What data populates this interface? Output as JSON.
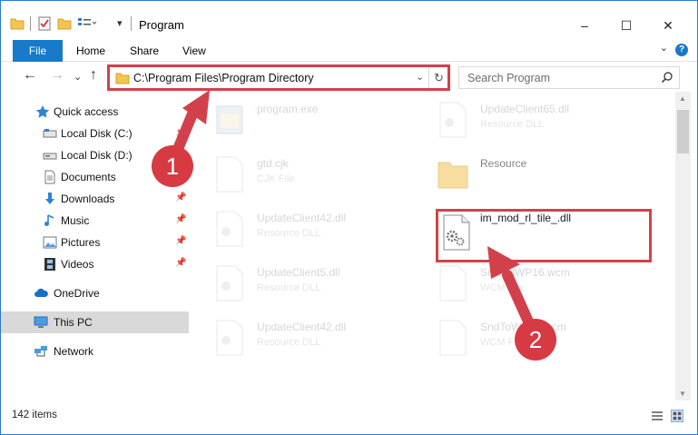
{
  "window": {
    "title": "Program",
    "minimize": "–",
    "maximize": "☐",
    "close": "✕"
  },
  "ribbon": {
    "file": "File",
    "home": "Home",
    "share": "Share",
    "view": "View",
    "help": "?"
  },
  "address": {
    "path": "C:\\Program Files\\Program Directory",
    "dropdown": "⌄",
    "refresh": "↻"
  },
  "search": {
    "placeholder": "Search Program"
  },
  "nav": {
    "back": "←",
    "forward": "→",
    "recent": "⌄",
    "up": "↑",
    "items": [
      {
        "label": "Quick access"
      },
      {
        "label": "Local Disk (C:)"
      },
      {
        "label": "Local Disk (D:)"
      },
      {
        "label": "Documents"
      },
      {
        "label": "Downloads"
      },
      {
        "label": "Music"
      },
      {
        "label": "Pictures"
      },
      {
        "label": "Videos"
      },
      {
        "label": "OneDrive"
      },
      {
        "label": "This PC"
      },
      {
        "label": "Network"
      }
    ],
    "pin": "📌"
  },
  "files": [
    {
      "name": "program.exe",
      "type": ""
    },
    {
      "name": "UpdateClient65.dll",
      "type": "Resource DLL"
    },
    {
      "name": "gtd.cjk",
      "type": "CJK File"
    },
    {
      "name": "Resource",
      "type": ""
    },
    {
      "name": "UpdateClient42.dll",
      "type": "Resource DLL"
    },
    {
      "name": "im_mod_rl_tile_.dll",
      "type": ""
    },
    {
      "name": "UpdateClient5.dll",
      "type": "Resource DLL"
    },
    {
      "name": "SndVolWP16.wcm",
      "type": "WCM File"
    },
    {
      "name": "UpdateClient42.dll",
      "type": "Resource DLL"
    },
    {
      "name": "SndToWP16.wcm",
      "type": "WCM File"
    }
  ],
  "status": {
    "count": "142 items"
  },
  "steps": {
    "one": "1",
    "two": "2"
  },
  "colors": {
    "accent": "#1979ca",
    "highlight": "#d2414b",
    "folder": "#f4c451"
  }
}
